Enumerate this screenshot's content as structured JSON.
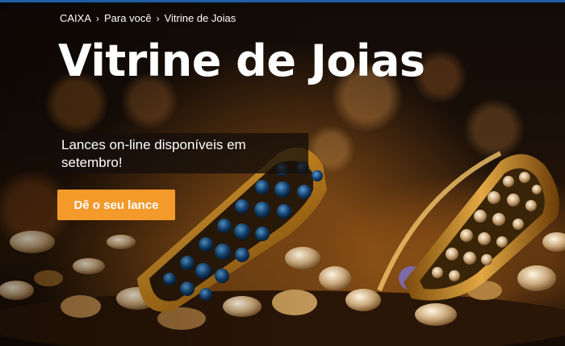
{
  "breadcrumb": {
    "items": [
      "CAIXA",
      "Para você",
      "Vitrine de Joias"
    ],
    "separator": "›"
  },
  "hero": {
    "title": "Vitrine de Joias",
    "subtitle": "Lances on-line disponíveis em setembro!",
    "cta_label": "Dê o seu lance"
  },
  "colors": {
    "top_bar": "#1f5fa6",
    "cta_background": "#f39a2b",
    "text": "#ffffff"
  },
  "icons": [
    "chevron-right-icon"
  ]
}
